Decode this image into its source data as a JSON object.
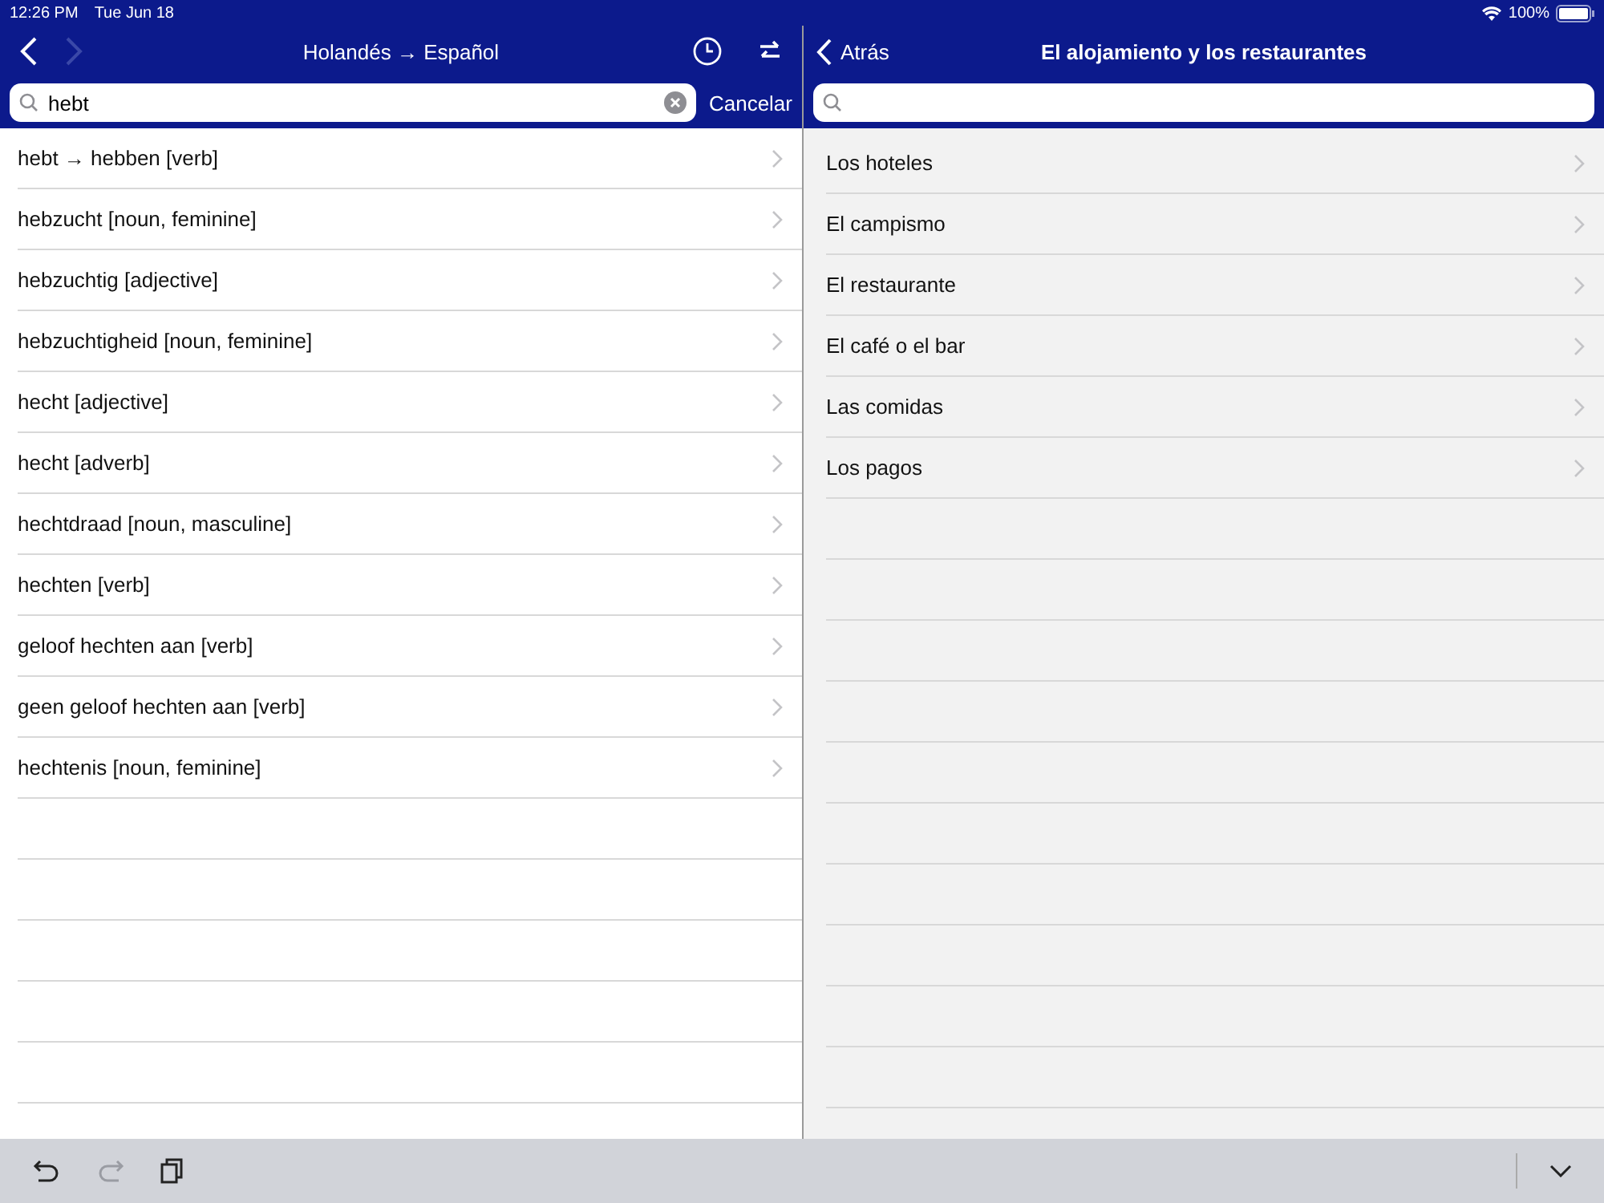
{
  "status_bar": {
    "time": "12:26 PM",
    "date": "Tue Jun 18",
    "battery": "100%"
  },
  "left": {
    "nav": {
      "back_disabled": false,
      "forward_disabled": true
    },
    "title": "Holandés → Español",
    "search": {
      "value": "hebt",
      "cancel": "Cancelar"
    },
    "results": [
      "hebt → hebben [verb]",
      "hebzucht [noun, feminine]",
      "hebzuchtig [adjective]",
      "hebzuchtigheid [noun, feminine]",
      "hecht [adjective]",
      "hecht [adverb]",
      "hechtdraad [noun, masculine]",
      "hechten [verb]",
      "geloof hechten aan [verb]",
      "geen geloof hechten aan [verb]",
      "hechtenis [noun, feminine]"
    ]
  },
  "right": {
    "back": "Atrás",
    "title": "El alojamiento y los restaurantes",
    "topics": [
      "Los hoteles",
      "El campismo",
      "El restaurante",
      "El café o el bar",
      "Las comidas",
      "Los pagos"
    ]
  },
  "toolbar": {
    "undo_disabled": false,
    "redo_disabled": true
  }
}
